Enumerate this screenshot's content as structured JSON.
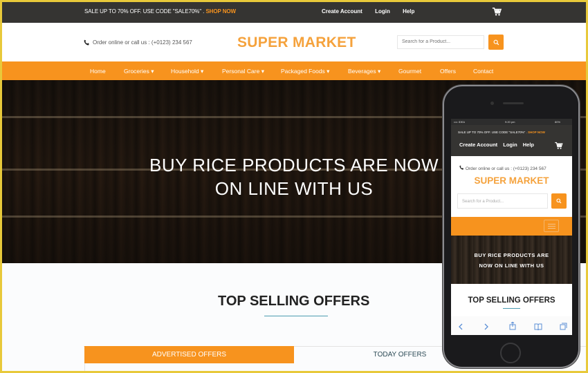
{
  "topbar": {
    "sale_text": "SALE UP TO 70% OFF. USE CODE \"SALE70%\" . ",
    "shop_now": "SHOP NOW",
    "links": [
      "Create Account",
      "Login",
      "Help"
    ],
    "cart_icon": "cart-icon"
  },
  "header": {
    "phone_icon": "phone-icon",
    "contact_text": "Order online or call us : (+0123) 234 567",
    "logo": "SUPER MARKET",
    "search_placeholder": "Search for a Product...",
    "search_icon": "search-icon"
  },
  "nav": {
    "items": [
      {
        "label": "Home"
      },
      {
        "label": "Groceries",
        "dropdown": true
      },
      {
        "label": "Household",
        "dropdown": true
      },
      {
        "label": "Personal Care",
        "dropdown": true
      },
      {
        "label": "Packaged Foods",
        "dropdown": true
      },
      {
        "label": "Beverages",
        "dropdown": true
      },
      {
        "label": "Gourmet"
      },
      {
        "label": "Offers"
      },
      {
        "label": "Contact"
      }
    ],
    "labels_rendered": [
      "Home",
      "Groceries ▾",
      "Household ▾",
      "Personal Care ▾",
      "Packaged Foods ▾",
      "Beverages ▾",
      "Gourmet",
      "Offers",
      "Contact"
    ]
  },
  "hero": {
    "line1": "BUY RICE PRODUCTS ARE NOW",
    "line2": "ON LINE WITH US"
  },
  "offers": {
    "title": "TOP SELLING OFFERS",
    "tabs": [
      {
        "label": "ADVERTISED OFFERS",
        "active": true
      },
      {
        "label": "TODAY OFFERS",
        "active": false
      }
    ]
  },
  "mobile": {
    "status": {
      "carrier": "•••• IDEA",
      "time": "9:20 pm",
      "battery": "80%"
    },
    "sale_text": "SALE UP TO 70% OFF. USE CODE \"SALE70%\" . ",
    "shop_now": "SHOP NOW",
    "links": [
      "Create Account",
      "Login",
      "Help"
    ],
    "contact_text": "Order online or call us : (+0123) 234 567",
    "logo": "SUPER MARKET",
    "search_placeholder": "Search for a Product...",
    "hero_line1": "BUY RICE PRODUCTS ARE",
    "hero_line2": "NOW ON LINE WITH US",
    "offers_title": "TOP SELLING OFFERS",
    "browser_icons": [
      "back-icon",
      "forward-icon",
      "share-icon",
      "bookmarks-icon",
      "tabs-icon"
    ]
  },
  "colors": {
    "accent": "#f7931e",
    "logo": "#f5a23c",
    "topbar": "#353432",
    "underline": "#4a9bb0"
  }
}
